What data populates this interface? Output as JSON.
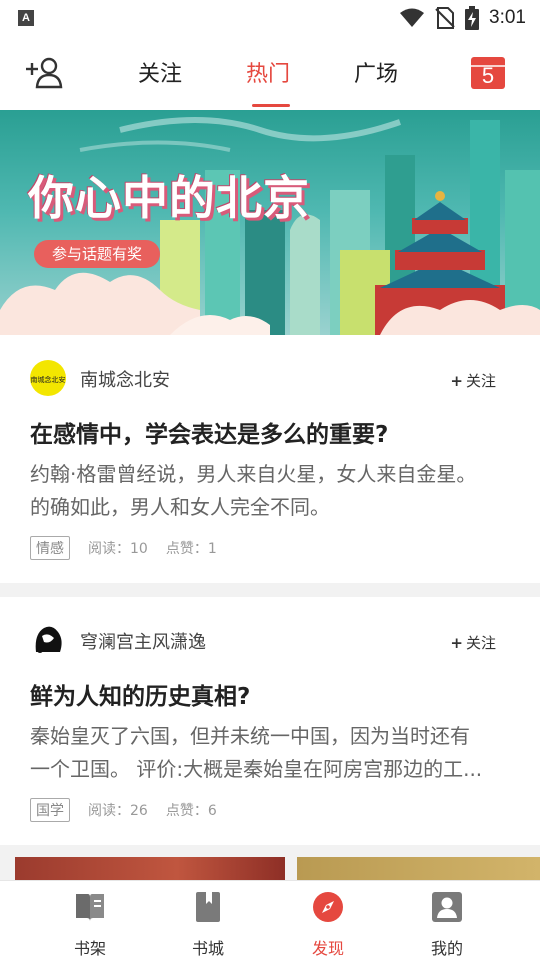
{
  "status_bar": {
    "app_icon": "A",
    "time": "3:01"
  },
  "top_nav": {
    "tabs": [
      {
        "label": "关注"
      },
      {
        "label": "热门"
      },
      {
        "label": "广场"
      }
    ],
    "active_tab": "热门",
    "calendar_day": "5",
    "accent_color": "#e5483f"
  },
  "banner": {
    "title": "你心中的北京",
    "button_label": "参与话题有奖"
  },
  "posts": [
    {
      "author": "南城念北安",
      "avatar_text": "南城念北安",
      "follow_label": "关注",
      "title": "在感情中，学会表达是多么的重要?",
      "excerpt_line1": "约翰·格雷曾经说，男人来自火星，女人来自金星。",
      "excerpt_line2": "的确如此，男人和女人完全不同。",
      "tag": "情感",
      "reads": "阅读：10",
      "likes": "点赞：1"
    },
    {
      "author": "穹澜宫主风潇逸",
      "follow_label": "关注",
      "title": "鲜为人知的历史真相?",
      "excerpt_line1": "秦始皇灭了六国，但并未统一中国，因为当时还有",
      "excerpt_line2": "一个卫国。 评价:大概是秦始皇在阿房宫那边的工...",
      "tag": "国学",
      "reads": "阅读：26",
      "likes": "点赞：6"
    }
  ],
  "bottom_nav": {
    "items": [
      {
        "label": "书架",
        "icon": "bookshelf-icon"
      },
      {
        "label": "书城",
        "icon": "bookstore-icon"
      },
      {
        "label": "发现",
        "icon": "compass-icon"
      },
      {
        "label": "我的",
        "icon": "profile-icon"
      }
    ],
    "active": "发现"
  }
}
